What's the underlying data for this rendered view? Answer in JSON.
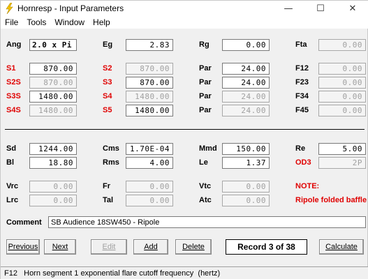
{
  "window": {
    "title": "Hornresp - Input Parameters"
  },
  "menu": [
    "File",
    "Tools",
    "Window",
    "Help"
  ],
  "labels": {
    "ang": "Ang",
    "eg": "Eg",
    "rg": "Rg",
    "fta": "Fta",
    "s1": "S1",
    "s2": "S2",
    "par1": "Par",
    "f12": "F12",
    "s2s": "S2S",
    "s3": "S3",
    "par2": "Par",
    "f23": "F23",
    "s3s": "S3S",
    "s4": "S4",
    "par3": "Par",
    "f34": "F34",
    "s4s": "S4S",
    "s5": "S5",
    "par4": "Par",
    "f45": "F45",
    "sd": "Sd",
    "cms": "Cms",
    "mmd": "Mmd",
    "re": "Re",
    "bl": "Bl",
    "rms": "Rms",
    "le": "Le",
    "od3": "OD3",
    "vrc": "Vrc",
    "fr": "Fr",
    "vtc": "Vtc",
    "note": "NOTE:",
    "lrc": "Lrc",
    "tal": "Tal",
    "atc": "Atc",
    "note_text": "Ripole folded baffle",
    "comment": "Comment"
  },
  "values": {
    "ang": "2.0 x Pi",
    "eg": "2.83",
    "rg": "0.00",
    "fta": "0.00",
    "s1": "870.00",
    "s2": "870.00",
    "par1": "24.00",
    "f12": "0.00",
    "s2s": "870.00",
    "s3": "870.00",
    "par2": "24.00",
    "f23": "0.00",
    "s3s": "1480.00",
    "s4": "1480.00",
    "par3": "24.00",
    "f34": "0.00",
    "s4s": "1480.00",
    "s5": "1480.00",
    "par4": "24.00",
    "f45": "0.00",
    "sd": "1244.00",
    "cms": "1.70E-04",
    "mmd": "150.00",
    "re": "5.00",
    "bl": "18.80",
    "rms": "4.00",
    "le": "1.37",
    "od3": "2P",
    "vrc": "0.00",
    "fr": "0.00",
    "vtc": "0.00",
    "lrc": "0.00",
    "tal": "0.00",
    "atc": "0.00"
  },
  "comment_value": "SB Audience 18SW450 - Ripole",
  "buttons": {
    "previous": "Previous",
    "next": "Next",
    "edit": "Edit",
    "add": "Add",
    "delete": "Delete",
    "calculate": "Calculate"
  },
  "record": "Record 3 of 38",
  "status": "F12   Horn segment 1 exponential flare cutoff frequency  (hertz)",
  "colors": {
    "red_label": "#e00000",
    "dim_text": "#a0a0a0"
  }
}
